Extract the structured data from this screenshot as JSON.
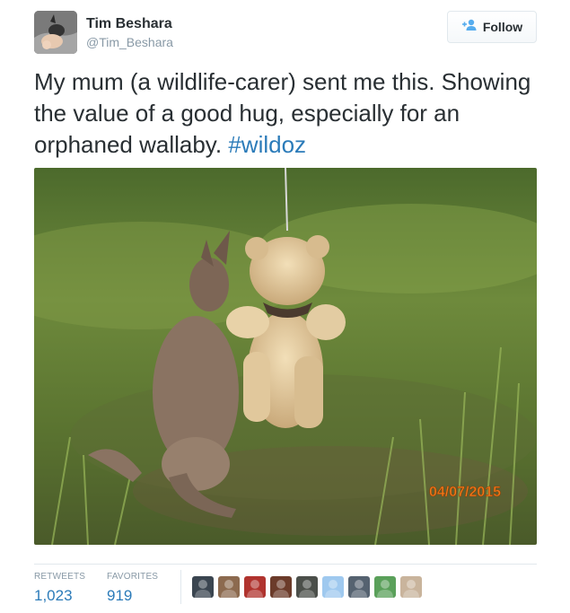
{
  "user": {
    "name": "Tim Beshara",
    "handle": "@Tim_Beshara"
  },
  "follow_button": {
    "label": "Follow",
    "icon": "add-user-icon"
  },
  "tweet": {
    "text": "My mum (a wildlife-carer) sent me this. Showing the value of a good hug, especially for an orphaned wallaby.",
    "hashtag": "#wildoz"
  },
  "photo": {
    "date_stamp": "04/07/2015"
  },
  "stats": {
    "retweets_label": "RETWEETS",
    "retweets_value": "1,023",
    "favorites_label": "FAVORITES",
    "favorites_value": "919"
  },
  "favoriters": [
    {
      "icon": "favoriter-avatar-1",
      "color": "#3a4550"
    },
    {
      "icon": "favoriter-avatar-2",
      "color": "#8c6a4f"
    },
    {
      "icon": "favoriter-avatar-3",
      "color": "#b0332e"
    },
    {
      "icon": "favoriter-avatar-4",
      "color": "#6b3b2a"
    },
    {
      "icon": "favoriter-avatar-5",
      "color": "#4b4f4a"
    },
    {
      "icon": "favoriter-avatar-6",
      "color": "#9fc9ef"
    },
    {
      "icon": "favoriter-avatar-7",
      "color": "#556270"
    },
    {
      "icon": "favoriter-avatar-8",
      "color": "#5aa05a"
    },
    {
      "icon": "favoriter-avatar-9",
      "color": "#c9b49c"
    }
  ],
  "colors": {
    "text": "#292f33",
    "muted": "#8899a6",
    "link": "#2b7bb9",
    "border": "#e1e8ed"
  }
}
